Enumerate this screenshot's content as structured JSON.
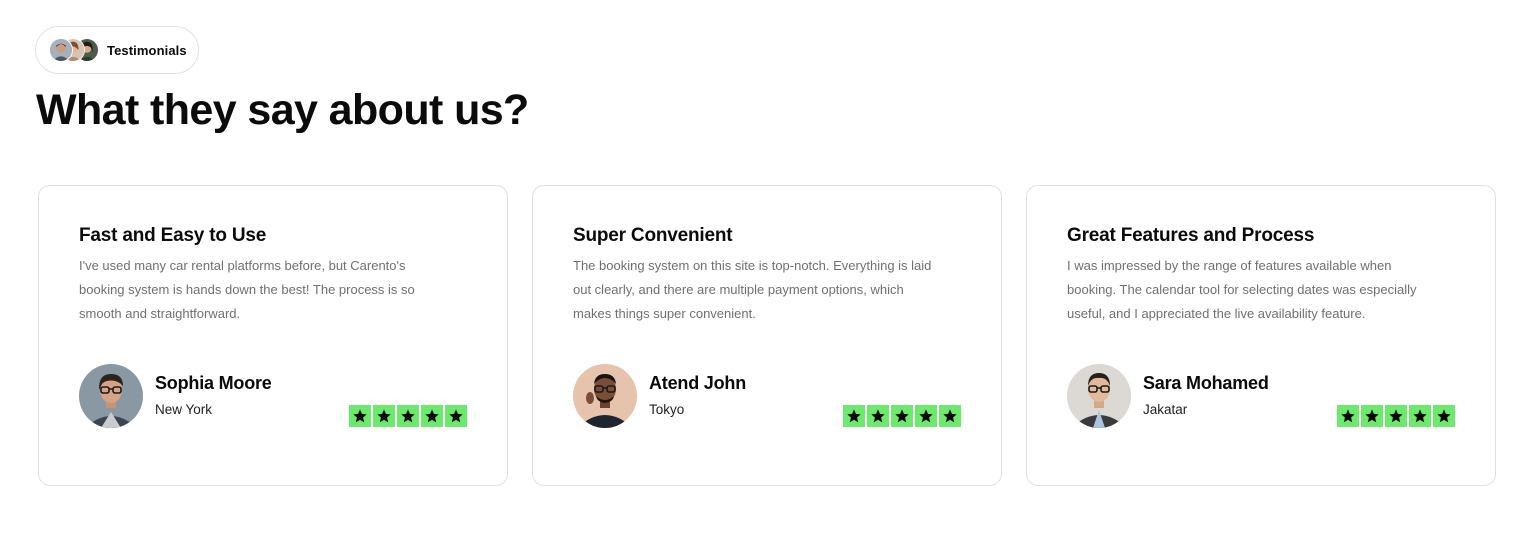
{
  "badge": {
    "label": "Testimonials"
  },
  "heading": "What they say about us?",
  "colors": {
    "star_background": "#6dea6d",
    "card_border": "#e0e0e0",
    "body_text": "#707070"
  },
  "testimonials": [
    {
      "title": "Fast and Easy to Use",
      "text": "I've used many car rental platforms before, but Carento's booking system is hands down the best! The process is so smooth and straightforward.",
      "name": "Sophia Moore",
      "location": "New York",
      "rating": 5
    },
    {
      "title": "Super Convenient",
      "text": "The booking system on this site is top-notch. Everything is laid out clearly, and there are multiple payment options, which makes things super convenient.",
      "name": "Atend John",
      "location": "Tokyo",
      "rating": 5
    },
    {
      "title": "Great Features and Process",
      "text": "I was impressed by the range of features available when booking. The calendar tool for selecting dates was especially useful, and I appreciated the live availability feature.",
      "name": "Sara Mohamed",
      "location": "Jakatar",
      "rating": 5
    }
  ]
}
